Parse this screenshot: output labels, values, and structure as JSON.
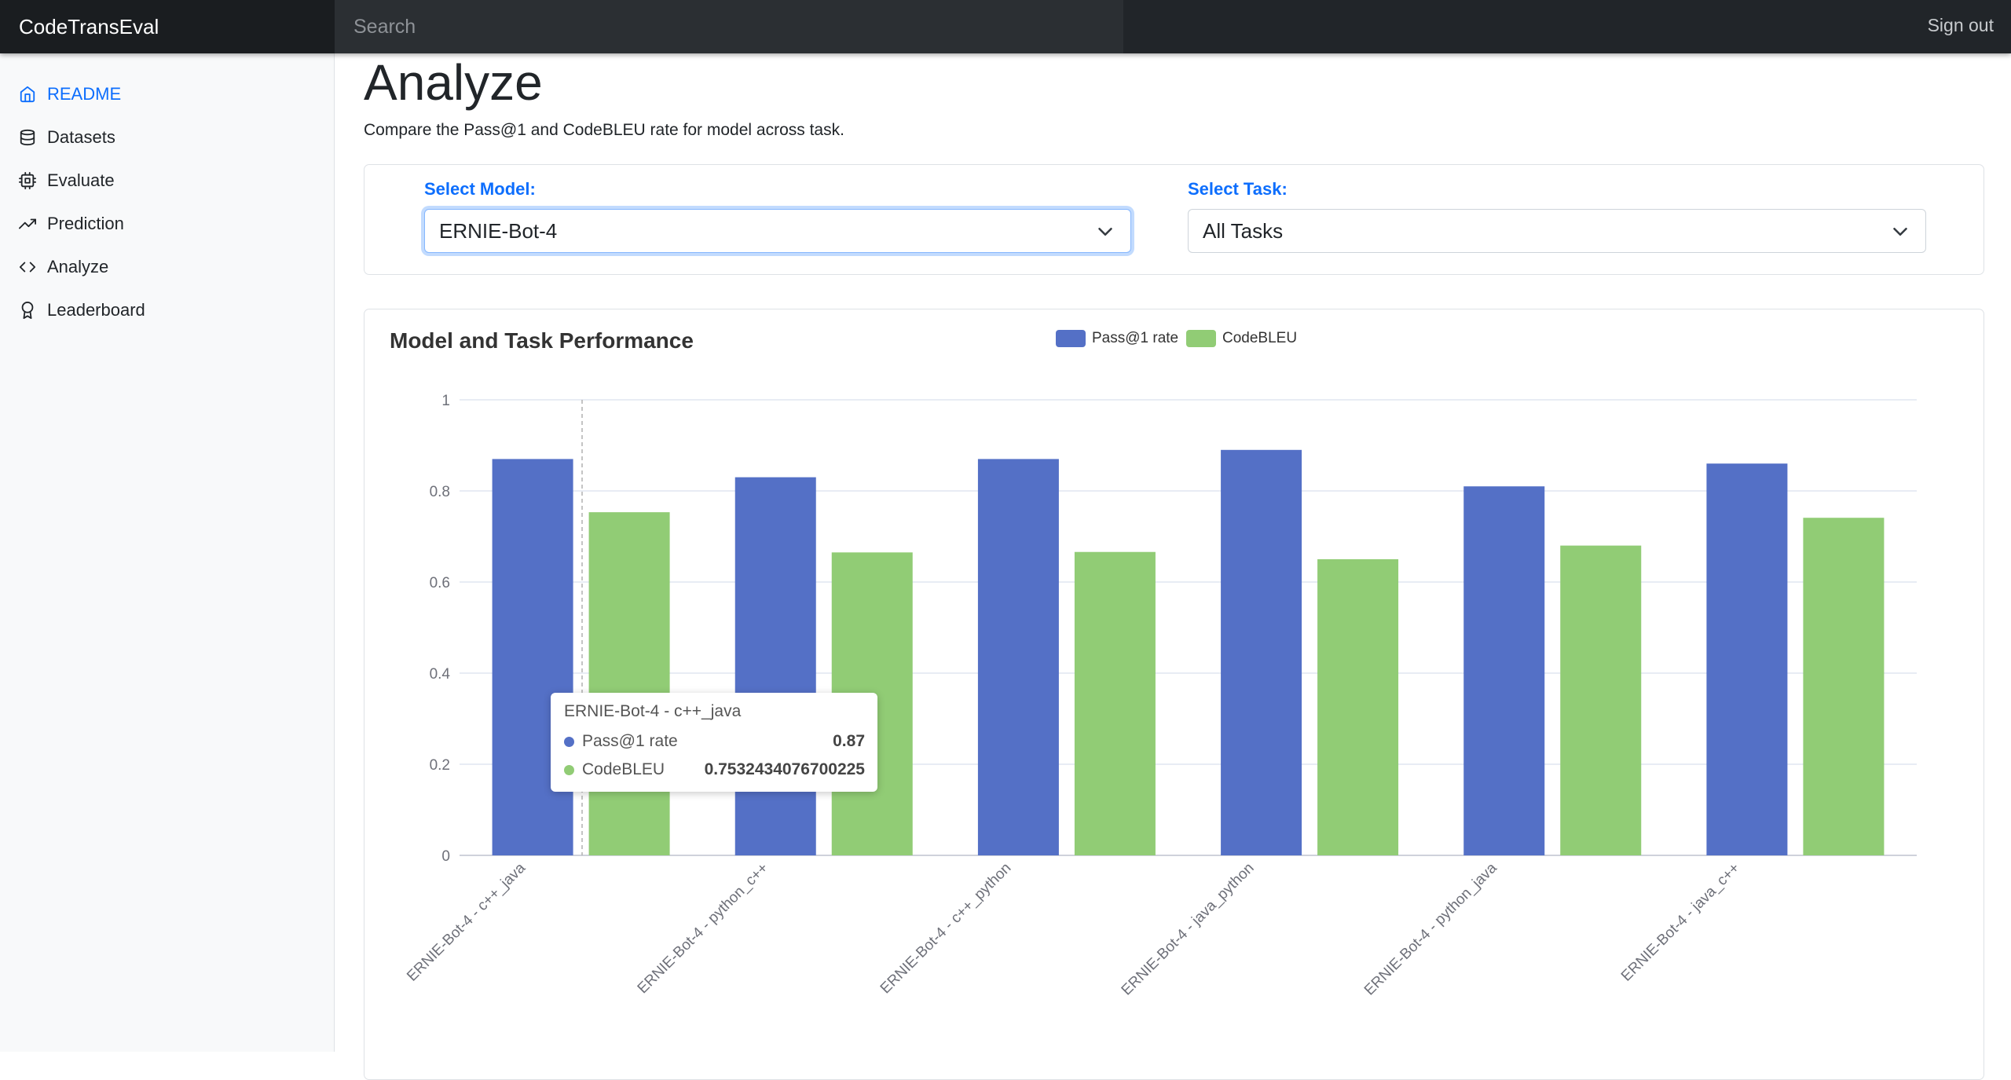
{
  "app": {
    "brand": "CodeTransEval",
    "search_placeholder": "Search",
    "sign_out": "Sign out"
  },
  "sidebar": {
    "items": [
      {
        "label": "README",
        "icon": "home-icon",
        "active": true
      },
      {
        "label": "Datasets",
        "icon": "database-icon"
      },
      {
        "label": "Evaluate",
        "icon": "cpu-icon"
      },
      {
        "label": "Prediction",
        "icon": "trending-up-icon"
      },
      {
        "label": "Analyze",
        "icon": "code-icon"
      },
      {
        "label": "Leaderboard",
        "icon": "award-icon"
      }
    ]
  },
  "page": {
    "title": "Analyze",
    "subtitle": "Compare the Pass@1 and CodeBLEU rate for model across task."
  },
  "filters": {
    "model_label": "Select Model:",
    "model_value": "ERNIE-Bot-4",
    "task_label": "Select Task:",
    "task_value": "All Tasks"
  },
  "colors": {
    "pass_at_1": "#5470c6",
    "codebleu": "#91cc75",
    "accent": "#0d6efd"
  },
  "chart_data": {
    "type": "bar",
    "title": "Model and Task Performance",
    "categories": [
      "ERNIE-Bot-4 - c++_java",
      "ERNIE-Bot-4 - python_c++",
      "ERNIE-Bot-4 - c++_python",
      "ERNIE-Bot-4 - java_python",
      "ERNIE-Bot-4 - python_java",
      "ERNIE-Bot-4 - java_c++"
    ],
    "series": [
      {
        "name": "Pass@1 rate",
        "values": [
          0.87,
          0.83,
          0.87,
          0.89,
          0.81,
          0.86
        ]
      },
      {
        "name": "CodeBLEU",
        "values": [
          0.7532434076700225,
          0.665,
          0.666,
          0.65,
          0.68,
          0.741
        ]
      }
    ],
    "ylim": [
      0,
      1
    ],
    "yticks": [
      "0",
      "0.2",
      "0.4",
      "0.6",
      "0.8",
      "1"
    ],
    "grid": true,
    "legend_position": "top-center",
    "tooltip": {
      "title": "ERNIE-Bot-4 - c++_java",
      "rows": [
        {
          "name": "Pass@1 rate",
          "value": "0.87"
        },
        {
          "name": "CodeBLEU",
          "value": "0.7532434076700225"
        }
      ]
    }
  }
}
